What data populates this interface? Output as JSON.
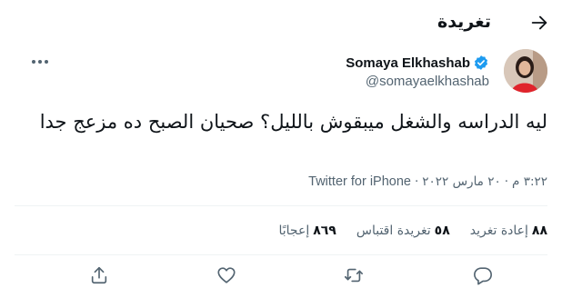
{
  "header": {
    "title": "تغريدة"
  },
  "author": {
    "name": "Somaya Elkhashab",
    "handle": "@somayaelkhashab",
    "verified_color": "#1d9bf0"
  },
  "tweet": {
    "text": "ليه الدراسه والشغل ميبقوش بالليل؟ صحيان الصبح ده مزعج جدا",
    "time": "٣:٢٢ م",
    "date": "٢٠ مارس ٢٠٢٢",
    "separator": "·",
    "source": "Twitter for iPhone"
  },
  "stats": [
    {
      "num": "٨٨",
      "label": "إعادة تغريد"
    },
    {
      "num": "٥٨",
      "label": "تغريدة اقتباس"
    },
    {
      "num": "٨٦٩",
      "label": "إعجابًا"
    }
  ],
  "icons": {
    "back": "arrow-icon",
    "more": "more-icon",
    "reply": "reply-icon",
    "retweet": "retweet-icon",
    "like": "heart-icon",
    "share": "share-icon"
  }
}
